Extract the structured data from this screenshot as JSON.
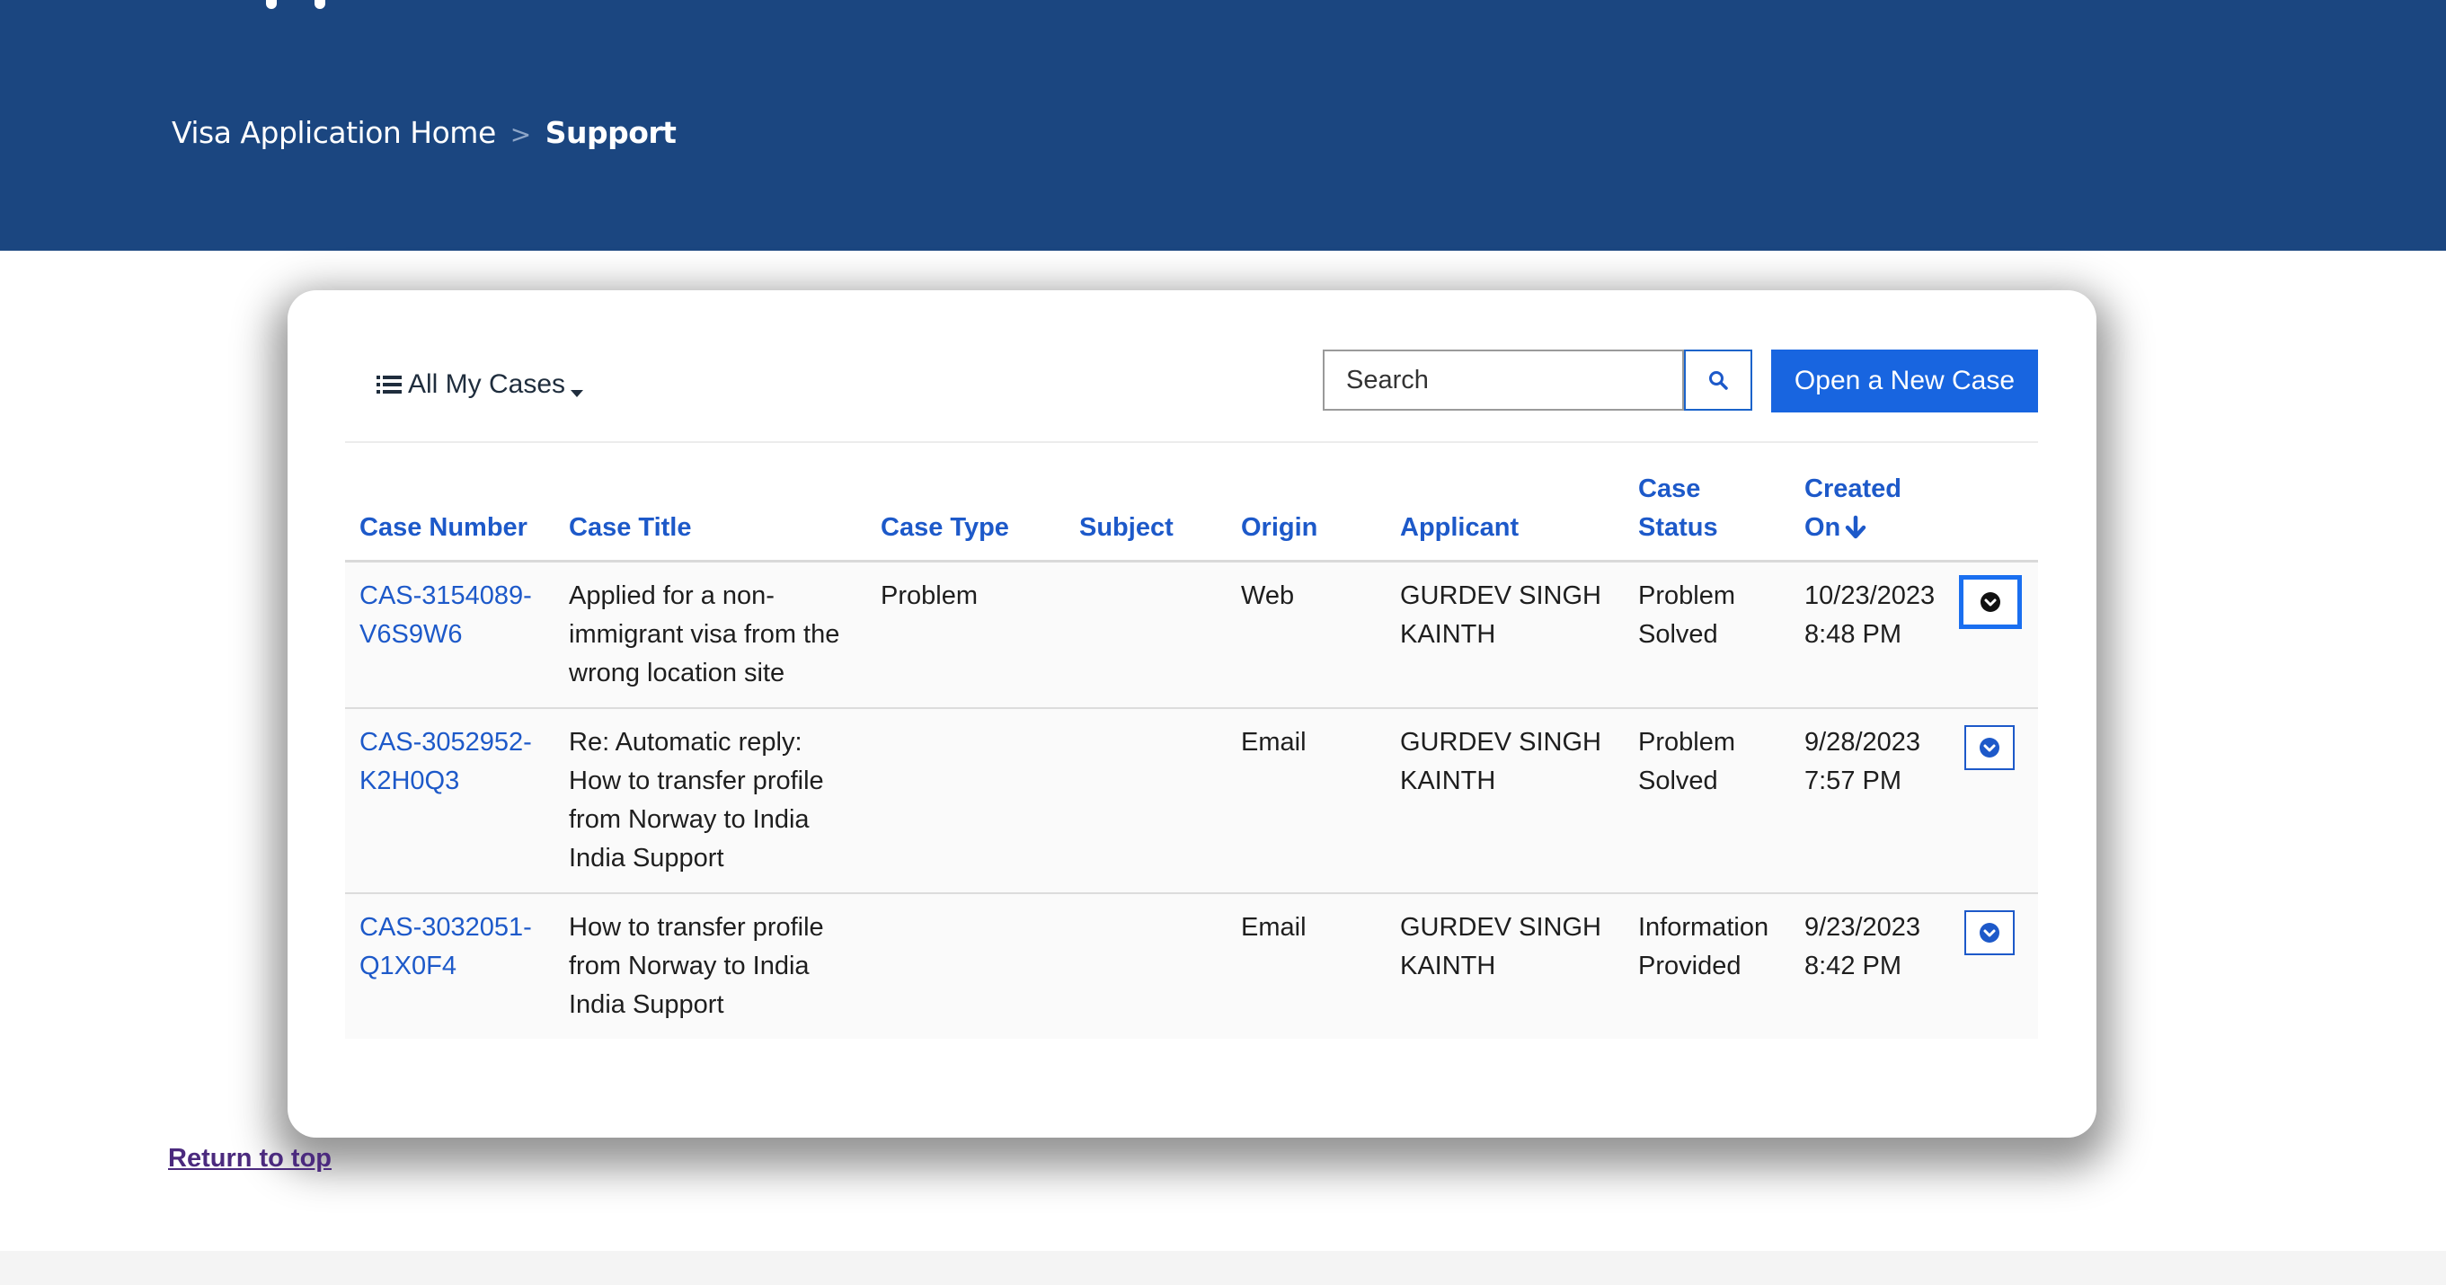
{
  "breadcrumb": {
    "home": "Visa Application Home",
    "separator": ">",
    "current": "Support"
  },
  "toolbar": {
    "view_label": "All My Cases",
    "search_placeholder": "Search",
    "new_case_label": "Open a New Case"
  },
  "table": {
    "columns": {
      "case_number": "Case Number",
      "case_title": "Case Title",
      "case_type": "Case Type",
      "subject": "Subject",
      "origin": "Origin",
      "applicant": "Applicant",
      "case_status_line1": "Case",
      "case_status_line2": "Status",
      "created_on_line1": "Created",
      "created_on_line2": "On"
    },
    "sort": {
      "column": "Created On",
      "direction": "descending"
    },
    "rows": [
      {
        "case_number_line1": "CAS-3154089-",
        "case_number_line2": "V6S9W6",
        "title": "Applied for a non-immigrant visa from the wrong location site",
        "type": "Problem",
        "subject": "",
        "origin": "Web",
        "applicant": "GURDEV SINGH KAINTH",
        "status": "Problem Solved",
        "created_date": "10/23/2023",
        "created_time": "8:48 PM"
      },
      {
        "case_number_line1": "CAS-3052952-",
        "case_number_line2": "K2H0Q3",
        "title": "Re: Automatic reply: How to transfer profile from Norway to India India Support",
        "type": "",
        "subject": "",
        "origin": "Email",
        "applicant": "GURDEV SINGH KAINTH",
        "status": "Problem Solved",
        "created_date": "9/28/2023",
        "created_time": "7:57 PM"
      },
      {
        "case_number_line1": "CAS-3032051-",
        "case_number_line2": "Q1X0F4",
        "title": "How to transfer profile from Norway to India India Support",
        "type": "",
        "subject": "",
        "origin": "Email",
        "applicant": "GURDEV SINGH KAINTH",
        "status": "Information Provided",
        "created_date": "9/23/2023",
        "created_time": "8:42 PM"
      }
    ]
  },
  "footer": {
    "return_to_top": "Return to top"
  },
  "icons": {
    "view": "list-icon",
    "search": "search-icon",
    "sort": "arrow-down-icon",
    "row_action": "chevron-down-circle-icon"
  },
  "colors": {
    "header_bg": "#1b4680",
    "link": "#1d59c9",
    "primary_button": "#1865e0",
    "visited_link": "#4b2a7e"
  }
}
